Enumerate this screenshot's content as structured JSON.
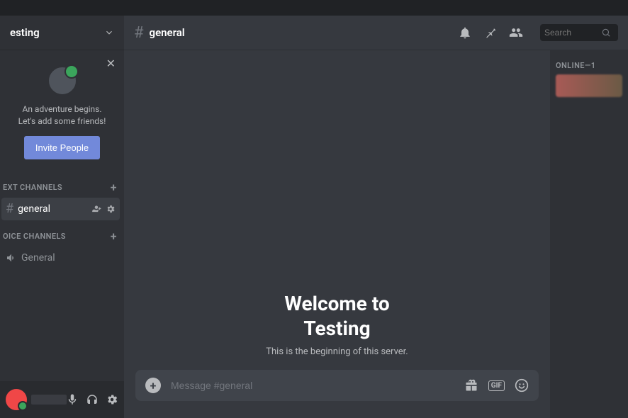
{
  "server": {
    "name": "esting"
  },
  "invite_card": {
    "line1": "An adventure begins.",
    "line2": "Let's add some friends!",
    "button": "Invite People"
  },
  "sections": {
    "text_label": "ext channels",
    "voice_label": "oice channels"
  },
  "channels": {
    "text": [
      {
        "name": "general",
        "active": true
      }
    ],
    "voice": [
      {
        "name": "General"
      }
    ]
  },
  "header": {
    "channel": "general",
    "search_placeholder": "Search"
  },
  "welcome": {
    "line1": "Welcome to",
    "line2": "Testing",
    "subtitle": "This is the beginning of this server."
  },
  "composer": {
    "placeholder": "Message #general",
    "gif_label": "GIF"
  },
  "members": {
    "online_label": "ONLINE—1"
  }
}
